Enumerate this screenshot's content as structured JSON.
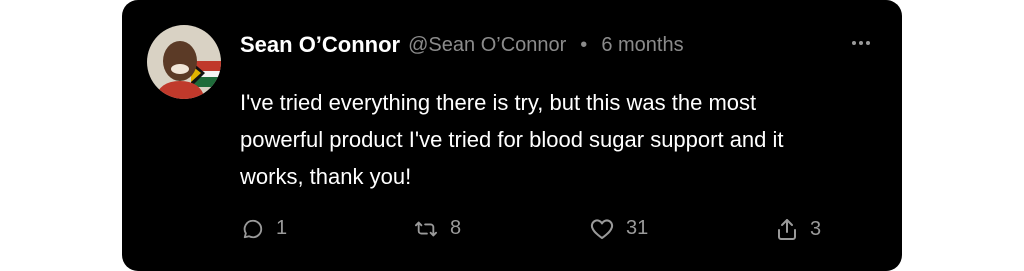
{
  "post": {
    "author_name": "Sean O’Connor",
    "author_handle": "@Sean O’Connor",
    "separator": "•",
    "timestamp": "6 months",
    "text": "I've tried everything there is try, but this was the most powerful product I've tried for blood sugar support and it works, thank you!",
    "actions": {
      "replies": "1",
      "reposts": "8",
      "likes": "31",
      "shares": "3"
    }
  },
  "icons": {
    "more": "more-dots-icon",
    "reply": "comment-bubble-icon",
    "repost": "repost-arrows-icon",
    "like": "heart-icon",
    "share": "share-upload-icon"
  },
  "colors": {
    "card_background": "#000000",
    "page_background": "#ffffff",
    "primary_text": "#ffffff",
    "secondary_text": "#8b8b8b"
  }
}
